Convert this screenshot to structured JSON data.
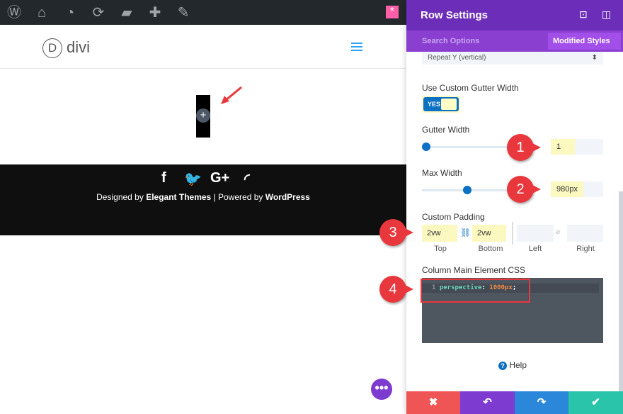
{
  "admin_bar": {
    "icons": [
      "wordpress-icon",
      "home-icon",
      "dashboard-icon",
      "refresh-icon",
      "comment-icon",
      "plus-icon",
      "pencil-icon"
    ],
    "divi_icon": "asterisk-icon"
  },
  "site": {
    "logo_letter": "D",
    "logo_text": "divi",
    "footer": {
      "social": [
        "f",
        "t",
        "G+",
        "rss"
      ],
      "designed_by": "Designed by ",
      "elegant": "Elegant Themes",
      "sep": " | Powered by ",
      "wordpress": "WordPress"
    },
    "add_icon": "+",
    "fab": "•••"
  },
  "panel": {
    "title": "Row Settings",
    "search_placeholder": "Search Options",
    "modified_styles": "Modified Styles",
    "repeat_value": "Repeat Y (vertical)",
    "gutter_toggle_label": "Use Custom Gutter Width",
    "gutter_toggle_value": "YES",
    "gutter_width_label": "Gutter Width",
    "gutter_width_value": "1",
    "max_width_label": "Max Width",
    "max_width_value": "980px",
    "padding_label": "Custom Padding",
    "padding": {
      "top": "2vw",
      "bottom": "2vw",
      "left": "",
      "right": "",
      "labels": [
        "Top",
        "Bottom",
        "Left",
        "Right"
      ]
    },
    "css_label": "Column Main Element CSS",
    "css_line_no": "1",
    "css_prop": "perspective",
    "css_colon": ": ",
    "css_value": "1000px",
    "css_semi": ";",
    "help": "Help",
    "footer_buttons": {
      "cancel": "✖",
      "undo": "↶",
      "redo": "↷",
      "save": "✔"
    }
  },
  "markers": [
    "1",
    "2",
    "3",
    "4"
  ],
  "colors": {
    "purple": "#6c2eb9",
    "blue": "#0c71c3",
    "red": "#ef5555",
    "green": "#29c4a9",
    "highlight": "#fbf8c0"
  }
}
